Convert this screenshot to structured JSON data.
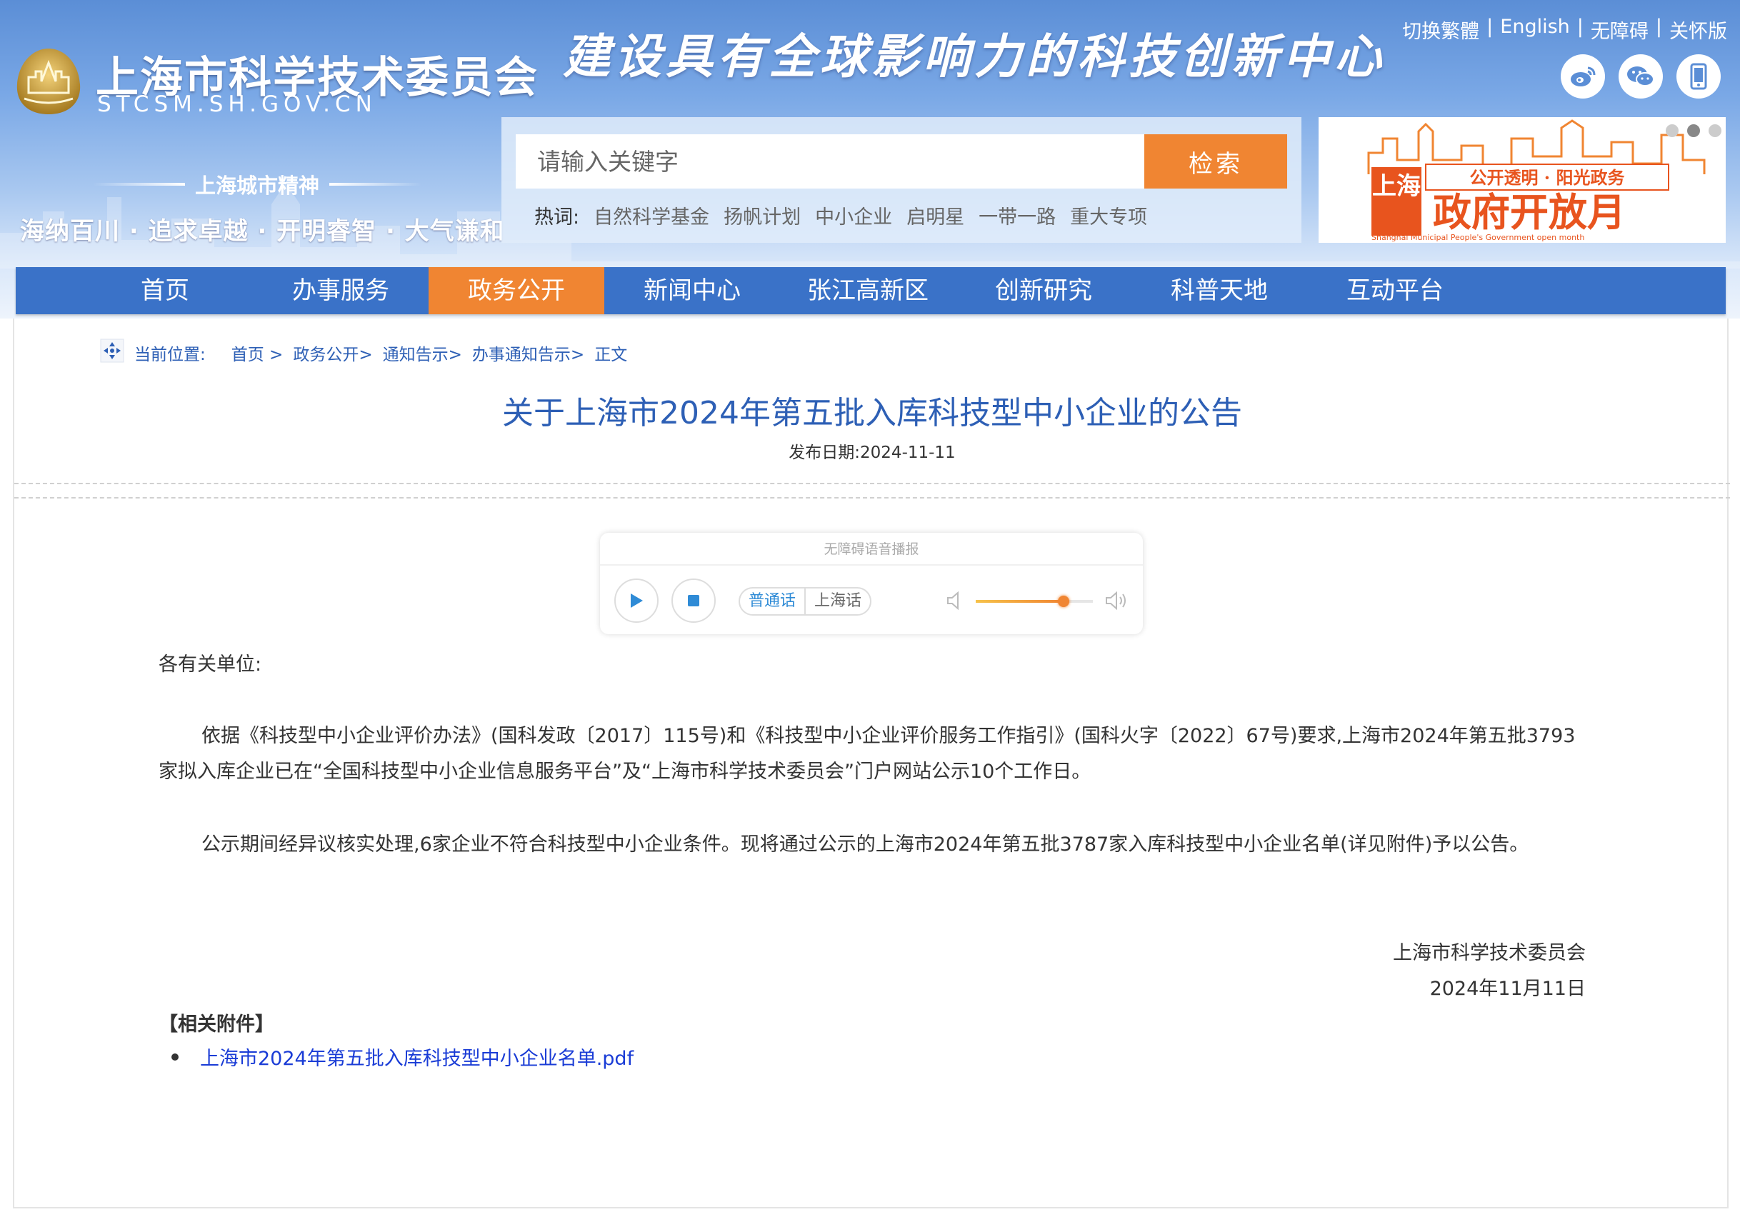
{
  "header": {
    "site_title": "上海市科学技术委员会",
    "site_domain": "STCSM.SH.GOV.CN",
    "slogan": "建设具有全球影响力的科技创新中心",
    "spirit_title": "上海城市精神",
    "spirit_motto": "海纳百川 · 追求卓越 · 开明睿智 · 大气谦和",
    "top_links": [
      "切换繁體",
      "English",
      "无障碍",
      "关怀版"
    ],
    "social_icons": [
      "weibo-icon",
      "wechat-icon",
      "mobile-icon"
    ]
  },
  "search": {
    "placeholder": "请输入关键字",
    "button_label": "检索",
    "hot_label": "热词:",
    "hot_words": [
      "自然科学基金",
      "扬帆计划",
      "中小企业",
      "启明星",
      "一带一路",
      "重大专项"
    ]
  },
  "banner": {
    "top_text": "公开透明 · 阳光政务",
    "city": "上海",
    "main_text": "政府开放月",
    "en_text": "Shanghai Municipal People's Government open month"
  },
  "nav": {
    "items": [
      "首页",
      "办事服务",
      "政务公开",
      "新闻中心",
      "张江高新区",
      "创新研究",
      "科普天地",
      "互动平台"
    ],
    "active_index": 2
  },
  "breadcrumb": {
    "label": "当前位置:",
    "items": [
      "首页 >",
      "政务公开>",
      "通知告示>",
      "办事通知告示>",
      "正文"
    ]
  },
  "article": {
    "title": "关于上海市2024年第五批入库科技型中小企业的公告",
    "publish_date": "发布日期:2024-11-11",
    "greeting": "各有关单位:",
    "paragraphs": [
      "依据《科技型中小企业评价办法》(国科发政〔2017〕115号)和《科技型中小企业评价服务工作指引》(国科火字〔2022〕67号)要求,上海市2024年第五批3793家拟入库企业已在“全国科技型中小企业信息服务平台”及“上海市科学技术委员会”门户网站公示10个工作日。",
      "公示期间经异议核实处理,6家企业不符合科技型中小企业条件。现将通过公示的上海市2024年第五批3787家入库科技型中小企业名单(详见附件)予以公告。"
    ],
    "signature_org": "上海市科学技术委员会",
    "signature_date": "2024年11月11日",
    "attachments_heading": "【相关附件】",
    "attachments": [
      "上海市2024年第五批入库科技型中小企业名单.pdf"
    ]
  },
  "player": {
    "title": "无障碍语音播报",
    "lang_options": [
      "普通话",
      "上海话"
    ],
    "selected_lang": "普通话",
    "volume": 0.75,
    "accent_color": "#f08532"
  },
  "colors": {
    "nav_bg": "#3a72c8",
    "nav_active": "#f08532",
    "title_blue": "#2d5fb5",
    "link_blue": "#1a3cd6"
  }
}
